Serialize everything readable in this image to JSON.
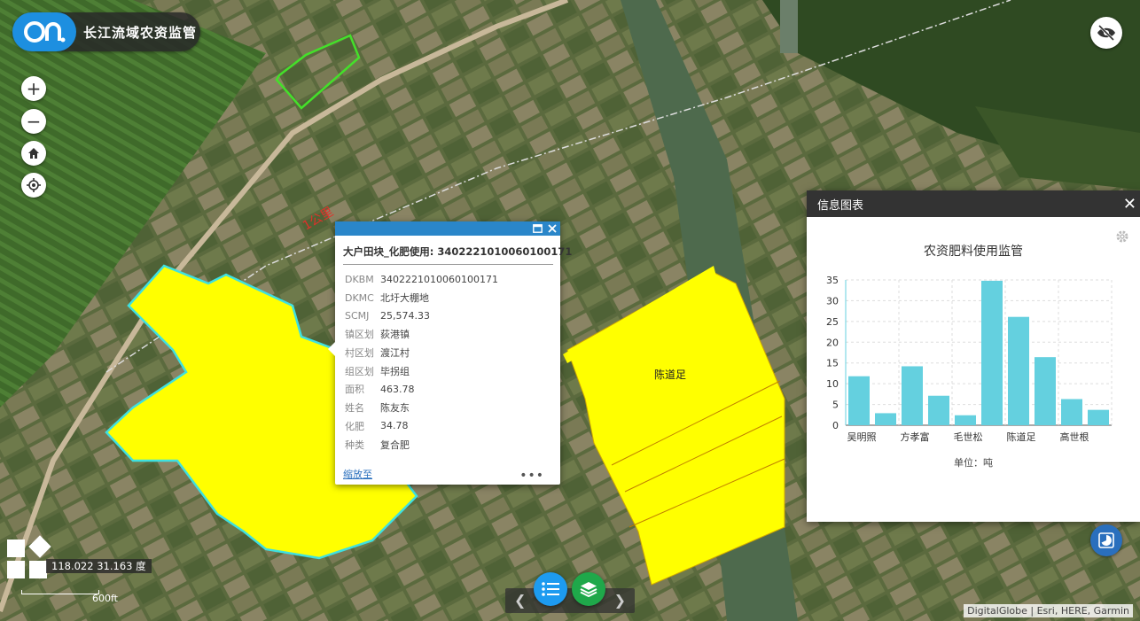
{
  "app": {
    "title": "长江流域农资监管"
  },
  "map": {
    "road_label": "1公里",
    "parcel_label": "陈道足",
    "coordinates": "118.022 31.163 度",
    "scale_label": "600ft",
    "attribution": "DigitalGlobe | Esri, HERE, Garmin"
  },
  "popup": {
    "title": "大户田块_化肥使用: 3402221010060100171",
    "rows": [
      {
        "key": "DKBM",
        "value": "3402221010060100171"
      },
      {
        "key": "DKMC",
        "value": "北圩大棚地"
      },
      {
        "key": "SCMJ",
        "value": "25,574.33"
      },
      {
        "key": "镇区划",
        "value": "荻港镇"
      },
      {
        "key": "村区划",
        "value": "渡江村"
      },
      {
        "key": "组区划",
        "value": "毕拐组"
      },
      {
        "key": "面积",
        "value": "463.78"
      },
      {
        "key": "姓名",
        "value": "陈友东"
      },
      {
        "key": "化肥",
        "value": "34.78"
      },
      {
        "key": "种类",
        "value": "复合肥"
      }
    ],
    "zoom_label": "缩放至",
    "more_label": "•••"
  },
  "chart_panel": {
    "title": "信息图表"
  },
  "chart_data": {
    "type": "bar",
    "title": "农资肥料使用监管",
    "xlabel": "单位：吨",
    "ylabel": "",
    "ylim": [
      0,
      35
    ],
    "yticks": [
      0,
      5,
      10,
      15,
      20,
      25,
      30,
      35
    ],
    "categories": [
      "吴明照",
      "",
      "方孝富",
      "",
      "毛世松",
      "",
      "陈道足",
      "",
      "高世根",
      ""
    ],
    "values": [
      11.8,
      2.9,
      14.2,
      7.1,
      2.4,
      34.8,
      26.1,
      16.4,
      6.3,
      3.7
    ],
    "bar_color": "#64d0df"
  }
}
